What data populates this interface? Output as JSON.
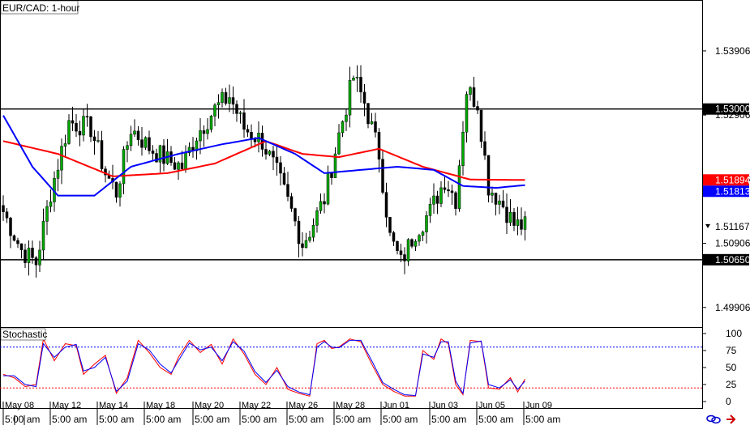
{
  "chart_data": [
    {
      "type": "candlestick",
      "title": "EUR/CAD: 1-hour",
      "ylim": [
        1.496,
        1.547
      ],
      "y_ticks": [
        "1.53906",
        "1.52906",
        "1.51906",
        "1.50906",
        "1.49906"
      ],
      "grid": false,
      "horizontal_lines": [
        {
          "value": 1.53,
          "label": "1.53000",
          "color": "#000000"
        },
        {
          "value": 1.5065,
          "label": "1.50650",
          "color": "#000000"
        }
      ],
      "price_labels": [
        {
          "value": 1.51894,
          "label": "1.51894",
          "color": "#ff0000"
        },
        {
          "value": 1.51813,
          "label": "1.51813",
          "color": "#0000ff"
        },
        {
          "value": 1.51167,
          "label": "1.51167",
          "color": "#000000"
        }
      ],
      "close_anchors": [
        [
          0,
          1.514
        ],
        [
          5,
          1.508
        ],
        [
          9,
          1.506
        ],
        [
          13,
          1.517
        ],
        [
          18,
          1.528
        ],
        [
          24,
          1.527
        ],
        [
          28,
          1.52
        ],
        [
          31,
          1.517
        ],
        [
          35,
          1.527
        ],
        [
          40,
          1.524
        ],
        [
          45,
          1.522
        ],
        [
          49,
          1.521
        ],
        [
          53,
          1.526
        ],
        [
          58,
          1.53
        ],
        [
          62,
          1.532
        ],
        [
          66,
          1.527
        ],
        [
          71,
          1.525
        ],
        [
          75,
          1.52
        ],
        [
          79,
          1.514
        ],
        [
          82,
          1.509
        ],
        [
          84,
          1.511
        ],
        [
          88,
          1.516
        ],
        [
          92,
          1.526
        ],
        [
          96,
          1.535
        ],
        [
          99,
          1.531
        ],
        [
          103,
          1.523
        ],
        [
          106,
          1.51
        ],
        [
          109,
          1.506
        ],
        [
          113,
          1.511
        ],
        [
          117,
          1.514
        ],
        [
          121,
          1.519
        ],
        [
          124,
          1.516
        ],
        [
          127,
          1.533
        ],
        [
          130,
          1.531
        ],
        [
          133,
          1.518
        ],
        [
          137,
          1.515
        ],
        [
          140,
          1.512
        ],
        [
          143,
          1.5117
        ]
      ],
      "moving_averages": [
        {
          "color": "#ff0000",
          "anchors": [
            [
              0,
              1.525
            ],
            [
              15,
              1.523
            ],
            [
              30,
              1.5195
            ],
            [
              45,
              1.52
            ],
            [
              58,
              1.5215
            ],
            [
              72,
              1.525
            ],
            [
              82,
              1.523
            ],
            [
              92,
              1.5225
            ],
            [
              103,
              1.5238
            ],
            [
              115,
              1.521
            ],
            [
              128,
              1.519
            ],
            [
              143,
              1.51894
            ]
          ]
        },
        {
          "color": "#0000ff",
          "anchors": [
            [
              0,
              1.529
            ],
            [
              8,
              1.521
            ],
            [
              15,
              1.5165
            ],
            [
              25,
              1.5165
            ],
            [
              35,
              1.521
            ],
            [
              48,
              1.523
            ],
            [
              60,
              1.5245
            ],
            [
              70,
              1.5255
            ],
            [
              80,
              1.523
            ],
            [
              88,
              1.52
            ],
            [
              98,
              1.5205
            ],
            [
              108,
              1.521
            ],
            [
              118,
              1.5205
            ],
            [
              126,
              1.518
            ],
            [
              135,
              1.5177
            ],
            [
              143,
              1.51813
            ]
          ]
        }
      ]
    },
    {
      "type": "line",
      "title": "Stochastic",
      "ylim": [
        0,
        100
      ],
      "y_ticks": [
        "100",
        "75",
        "50",
        "25",
        "0"
      ],
      "levels": [
        {
          "value": 80,
          "color": "#0000ff"
        },
        {
          "value": 20,
          "color": "#ff0000"
        }
      ],
      "series": [
        {
          "color": "#ff0000",
          "anchors": [
            [
              0,
              40
            ],
            [
              3,
              35
            ],
            [
              6,
              22
            ],
            [
              9,
              25
            ],
            [
              11,
              92
            ],
            [
              14,
              60
            ],
            [
              17,
              85
            ],
            [
              20,
              82
            ],
            [
              22,
              40
            ],
            [
              25,
              55
            ],
            [
              28,
              68
            ],
            [
              31,
              12
            ],
            [
              34,
              35
            ],
            [
              37,
              90
            ],
            [
              40,
              72
            ],
            [
              43,
              50
            ],
            [
              46,
              40
            ],
            [
              48,
              65
            ],
            [
              51,
              90
            ],
            [
              54,
              72
            ],
            [
              57,
              84
            ],
            [
              60,
              55
            ],
            [
              63,
              92
            ],
            [
              66,
              70
            ],
            [
              69,
              40
            ],
            [
              72,
              25
            ],
            [
              75,
              50
            ],
            [
              78,
              18
            ],
            [
              81,
              12
            ],
            [
              84,
              8
            ],
            [
              86,
              85
            ],
            [
              88,
              90
            ],
            [
              90,
              78
            ],
            [
              92,
              80
            ],
            [
              95,
              92
            ],
            [
              98,
              88
            ],
            [
              101,
              55
            ],
            [
              104,
              25
            ],
            [
              107,
              15
            ],
            [
              110,
              8
            ],
            [
              113,
              8
            ],
            [
              115,
              75
            ],
            [
              118,
              62
            ],
            [
              120,
              92
            ],
            [
              122,
              85
            ],
            [
              124,
              25
            ],
            [
              126,
              10
            ],
            [
              128,
              90
            ],
            [
              131,
              88
            ],
            [
              133,
              20
            ],
            [
              136,
              18
            ],
            [
              139,
              35
            ],
            [
              141,
              14
            ],
            [
              143,
              33
            ]
          ]
        },
        {
          "color": "#0000ff",
          "anchors": [
            [
              0,
              38
            ],
            [
              3,
              38
            ],
            [
              6,
              25
            ],
            [
              9,
              22
            ],
            [
              11,
              85
            ],
            [
              14,
              65
            ],
            [
              17,
              80
            ],
            [
              20,
              84
            ],
            [
              22,
              45
            ],
            [
              25,
              50
            ],
            [
              28,
              65
            ],
            [
              31,
              15
            ],
            [
              34,
              30
            ],
            [
              37,
              85
            ],
            [
              40,
              76
            ],
            [
              43,
              55
            ],
            [
              46,
              42
            ],
            [
              48,
              60
            ],
            [
              51,
              86
            ],
            [
              54,
              76
            ],
            [
              57,
              80
            ],
            [
              60,
              60
            ],
            [
              63,
              88
            ],
            [
              66,
              74
            ],
            [
              69,
              44
            ],
            [
              72,
              28
            ],
            [
              75,
              46
            ],
            [
              78,
              22
            ],
            [
              81,
              14
            ],
            [
              84,
              10
            ],
            [
              86,
              80
            ],
            [
              88,
              88
            ],
            [
              90,
              80
            ],
            [
              92,
              79
            ],
            [
              95,
              90
            ],
            [
              98,
              90
            ],
            [
              101,
              60
            ],
            [
              104,
              28
            ],
            [
              107,
              18
            ],
            [
              110,
              10
            ],
            [
              113,
              9
            ],
            [
              115,
              70
            ],
            [
              118,
              65
            ],
            [
              120,
              88
            ],
            [
              122,
              88
            ],
            [
              124,
              30
            ],
            [
              126,
              12
            ],
            [
              128,
              86
            ],
            [
              131,
              89
            ],
            [
              133,
              25
            ],
            [
              136,
              20
            ],
            [
              139,
              32
            ],
            [
              141,
              18
            ],
            [
              143,
              30
            ]
          ]
        }
      ]
    }
  ],
  "x_axis": {
    "date_labels": [
      "May 08",
      "May 12",
      "May 14",
      "May 18",
      "May 20",
      "May 22",
      "May 26",
      "May 28",
      "Jun 01",
      "Jun 03",
      "Jun 05",
      "Jun 09"
    ],
    "time_labels": [
      "5:00 am",
      "5:00 am",
      "5:00 am",
      "5:00 am",
      "5:00 am",
      "5:00 am",
      "5:00 am",
      "5:00 am",
      "5:00 am",
      "5:00 am",
      "5:00 am",
      "5:00 am"
    ]
  },
  "colors": {
    "bull_candle": "#00aa00",
    "bear_candle": "#000000",
    "separator": "#000000"
  },
  "icons": [
    "link-icon",
    "arrow-icon"
  ]
}
